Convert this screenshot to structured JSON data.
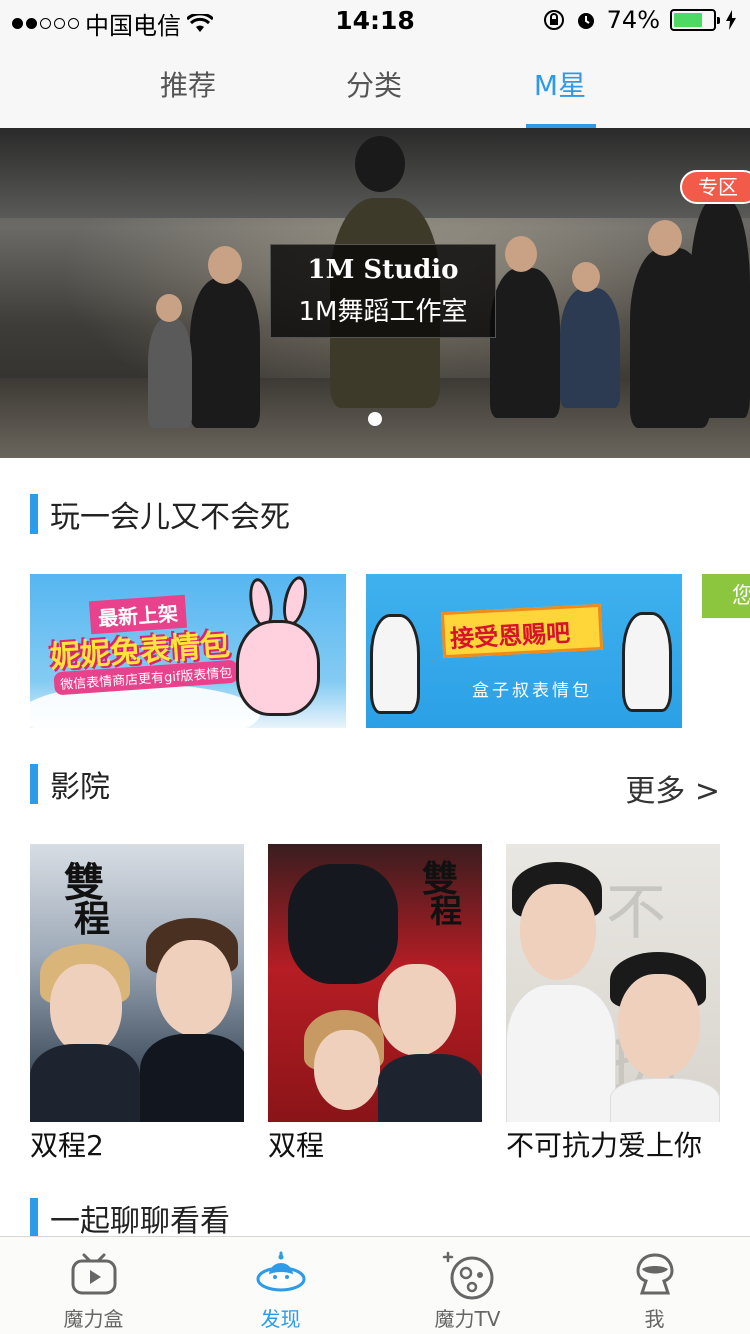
{
  "status_bar": {
    "carrier": "中国电信",
    "time": "14:18",
    "battery_percent": "74%",
    "battery_level": 0.74,
    "signal_bars": 2
  },
  "top_tabs": [
    {
      "label": "推荐",
      "active": false
    },
    {
      "label": "分类",
      "active": false
    },
    {
      "label": "M星",
      "active": true
    }
  ],
  "banner": {
    "caption_line1": "1M Studio",
    "caption_line2": "1M舞蹈工作室",
    "badge": "专区"
  },
  "section_play": {
    "title": "玩一会儿又不会死",
    "cards": [
      {
        "tag": "最新上架",
        "title": "妮妮兔表情包",
        "subtitle": "微信表情商店更有gif版表情包"
      },
      {
        "title": "接受恩赐吧",
        "subtitle": "盒子叔表情包"
      },
      {
        "title": "您"
      }
    ]
  },
  "section_cinema": {
    "title": "影院",
    "more": "更多 >",
    "movies": [
      {
        "title": "双程2"
      },
      {
        "title": "双程"
      },
      {
        "title": "不可抗力爱上你"
      }
    ]
  },
  "section_chat": {
    "title": "一起聊聊看看"
  },
  "tab_bar": [
    {
      "label": "魔力盒",
      "icon": "tv-box-icon",
      "active": false
    },
    {
      "label": "发现",
      "icon": "ufo-icon",
      "active": true
    },
    {
      "label": "魔力TV",
      "icon": "planet-icon",
      "active": false
    },
    {
      "label": "我",
      "icon": "alien-profile-icon",
      "active": false
    }
  ],
  "colors": {
    "accent": "#2d9be8",
    "badge": "#f25b4a",
    "battery": "#4cd964"
  }
}
